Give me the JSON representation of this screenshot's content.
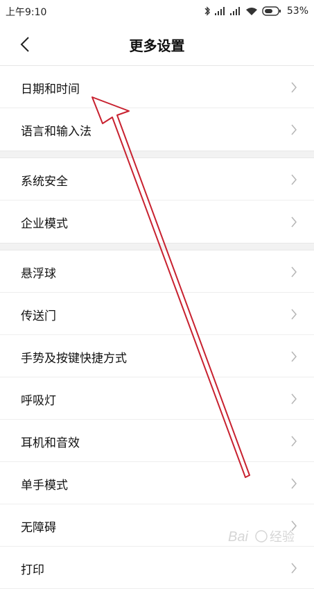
{
  "status_bar": {
    "time": "上午9:10",
    "battery_percent": "53%",
    "icons": [
      "bluetooth-icon",
      "signal-icon",
      "signal-icon",
      "wifi-icon",
      "battery-icon"
    ]
  },
  "header": {
    "title": "更多设置",
    "back_icon": "chevron-left-icon"
  },
  "groups": [
    {
      "items": [
        {
          "label": "日期和时间"
        },
        {
          "label": "语言和输入法"
        }
      ]
    },
    {
      "items": [
        {
          "label": "系统安全"
        },
        {
          "label": "企业模式"
        }
      ]
    },
    {
      "items": [
        {
          "label": "悬浮球"
        },
        {
          "label": "传送门"
        },
        {
          "label": "手势及按键快捷方式"
        },
        {
          "label": "呼吸灯"
        },
        {
          "label": "耳机和音效"
        },
        {
          "label": "单手模式"
        },
        {
          "label": "无障碍"
        },
        {
          "label": "打印"
        }
      ]
    }
  ],
  "annotation": {
    "color": "#c8212f",
    "icon": "red-arrow-pointer"
  },
  "watermark": {
    "text": "Baidu 经验"
  }
}
